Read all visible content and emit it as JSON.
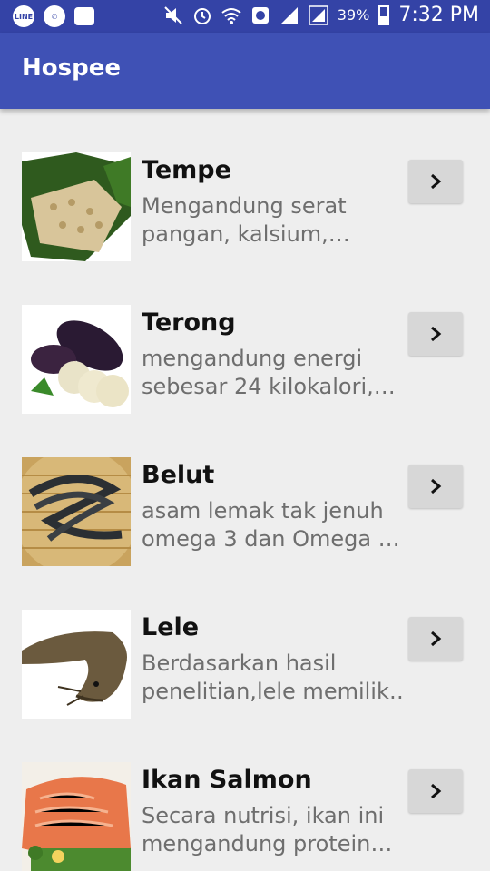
{
  "status_bar": {
    "left_icons": [
      "line-icon",
      "whatsapp-icon",
      "bbm-icon"
    ],
    "right_icons": [
      "mute-icon",
      "alarm-icon",
      "wifi-icon",
      "data-saver-icon",
      "signal-icon",
      "signal-icon-2",
      "battery-icon"
    ],
    "battery_percent": "39%",
    "time": "7:32 PM",
    "line_label": "LINE"
  },
  "app_bar": {
    "title": "Hospee"
  },
  "items": [
    {
      "name": "Tempe",
      "desc": "Mengandung serat\npangan, kalsium,…",
      "icon": "chevron-right-icon"
    },
    {
      "name": "Terong",
      "desc": "mengandung energi\nsebesar 24 kilokalori,…",
      "icon": "chevron-right-icon"
    },
    {
      "name": "Belut",
      "desc": "asam lemak tak jenuh\nomega 3 dan Omega …",
      "icon": "chevron-right-icon"
    },
    {
      "name": "Lele",
      "desc": "Berdasarkan hasil\npenelitian,lele memilik…",
      "icon": "chevron-right-icon"
    },
    {
      "name": "Ikan Salmon",
      "desc": "Secara nutrisi, ikan ini\nmengandung protein…",
      "icon": "chevron-right-icon"
    }
  ],
  "colors": {
    "primary": "#3f51b5",
    "status_bar": "#3443a6",
    "background": "#eeeeee",
    "button": "#d7d7d7"
  }
}
